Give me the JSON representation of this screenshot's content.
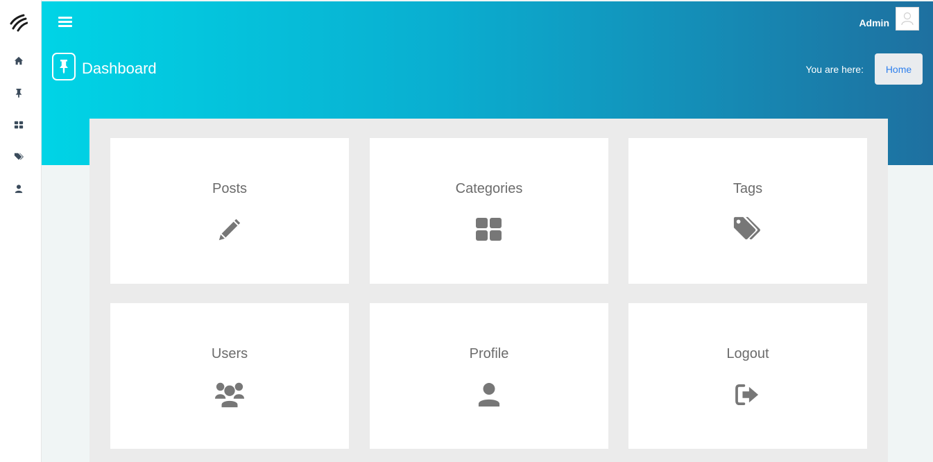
{
  "header": {
    "user_name": "Admin",
    "page_title": "Dashboard",
    "breadcrumb_label": "You are here:",
    "breadcrumb_home": "Home",
    "gradient_start": "#00d4e6",
    "gradient_end": "#1e70a0"
  },
  "sidebar": {
    "items": [
      {
        "icon": "home-icon"
      },
      {
        "icon": "pin-icon"
      },
      {
        "icon": "grid-icon"
      },
      {
        "icon": "tags-icon"
      },
      {
        "icon": "user-icon"
      }
    ]
  },
  "cards": [
    {
      "title": "Posts",
      "icon": "pencil-icon"
    },
    {
      "title": "Categories",
      "icon": "grid-icon"
    },
    {
      "title": "Tags",
      "icon": "tags-icon"
    },
    {
      "title": "Users",
      "icon": "users-icon"
    },
    {
      "title": "Profile",
      "icon": "user-icon"
    },
    {
      "title": "Logout",
      "icon": "logout-icon"
    }
  ],
  "colors": {
    "card_icon": "#777777",
    "link": "#2f80ed",
    "sidebar_icon": "#3b4b5b"
  }
}
